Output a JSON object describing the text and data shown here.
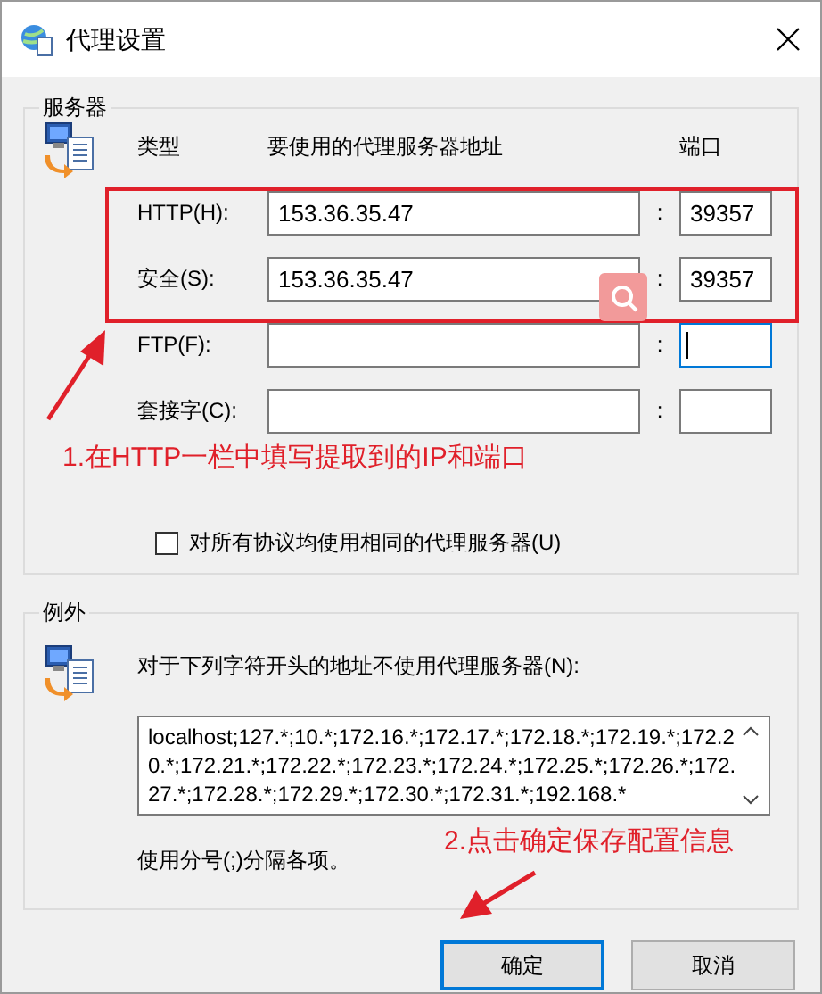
{
  "window": {
    "title": "代理设置"
  },
  "servers": {
    "title": "服务器",
    "headers": [
      "类型",
      "要使用的代理服务器地址",
      "端口"
    ],
    "rows": [
      {
        "label": "HTTP(H):",
        "address": "153.36.35.47",
        "port": "39357",
        "port_focused": false
      },
      {
        "label": "安全(S):",
        "address": "153.36.35.47",
        "port": "39357",
        "port_focused": false
      },
      {
        "label": "FTP(F):",
        "port_focused": true
      },
      {
        "label": "套接字(C):",
        "port_focused": false
      }
    ],
    "separator": ":",
    "same_proxy": {
      "label": "对所有协议均使用相同的代理服务器(U)",
      "checked": false
    }
  },
  "exceptions": {
    "title": "例外",
    "prompt": "对于下列字符开头的地址不使用代理服务器(N):",
    "value": "localhost;127.*;10.*;172.16.*;172.17.*;172.18.*;172.19.*;172.20.*;172.21.*;172.22.*;172.23.*;172.24.*;172.25.*;172.26.*;172.27.*;172.28.*;172.29.*;172.30.*;172.31.*;192.168.*",
    "hint": "使用分号(;)分隔各项。"
  },
  "buttons": [
    {
      "label": "确定",
      "default": true
    },
    {
      "label": "取消",
      "default": false
    }
  ],
  "annotations": [
    {
      "text": "1.在HTTP一栏中填写提取到的IP和端口"
    },
    {
      "text": "2.点击确定保存配置信息"
    }
  ]
}
